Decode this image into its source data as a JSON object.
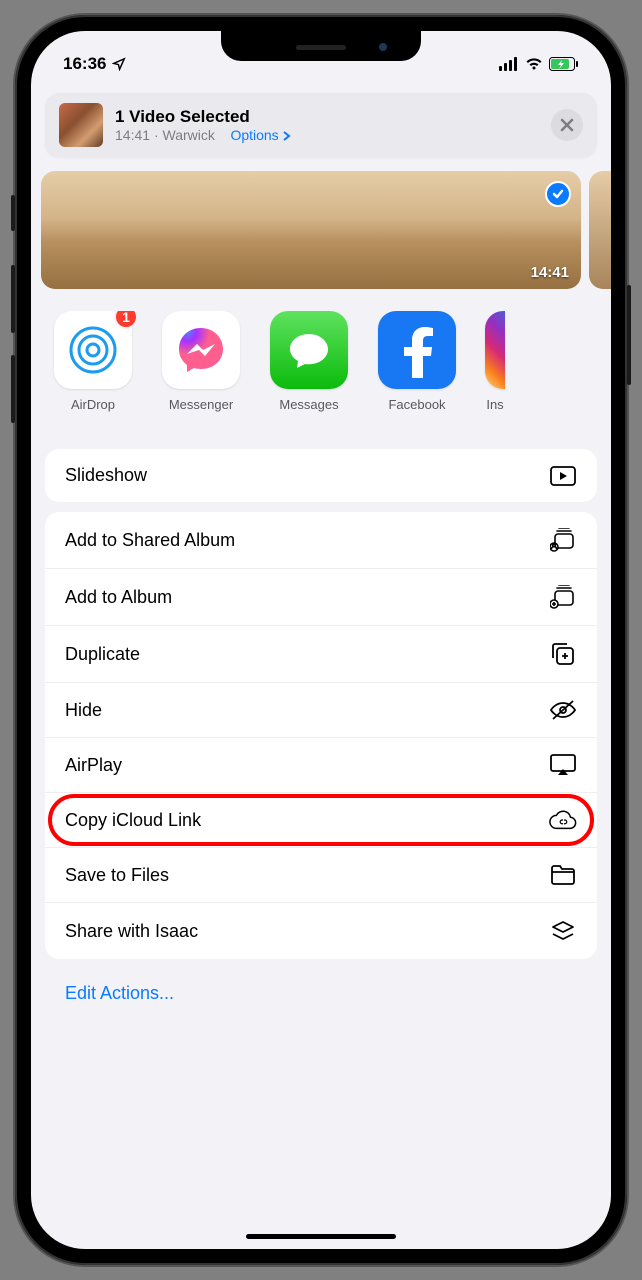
{
  "statusBar": {
    "time": "16:36"
  },
  "header": {
    "title": "1 Video Selected",
    "time": "14:41",
    "location": "Warwick",
    "optionsLabel": "Options"
  },
  "preview": {
    "timestamp": "14:41"
  },
  "apps": [
    {
      "name": "AirDrop",
      "badge": "1"
    },
    {
      "name": "Messenger"
    },
    {
      "name": "Messages"
    },
    {
      "name": "Facebook"
    },
    {
      "name": "Ins"
    }
  ],
  "actions": {
    "slideshow": "Slideshow",
    "addShared": "Add to Shared Album",
    "addAlbum": "Add to Album",
    "duplicate": "Duplicate",
    "hide": "Hide",
    "airplay": "AirPlay",
    "icloud": "Copy iCloud Link",
    "saveFiles": "Save to Files",
    "shareIsaac": "Share with Isaac",
    "edit": "Edit Actions..."
  }
}
